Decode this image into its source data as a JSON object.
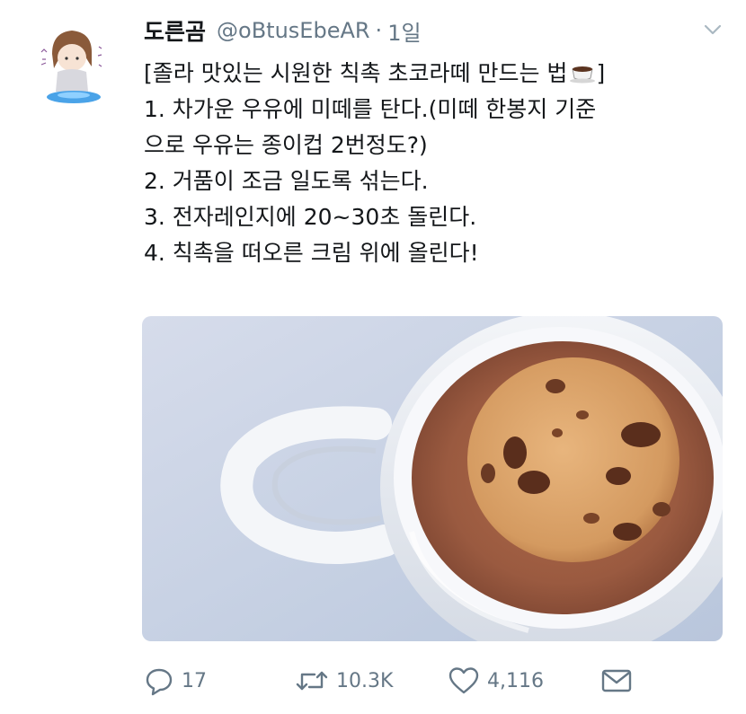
{
  "tweet": {
    "display_name": "도른곰",
    "handle": "@oBtusEbeAR",
    "separator": "·",
    "time": "1일",
    "text_lines": [
      "[졸라 맛있는 시원한 칙촉 초코라떼 만드는 법",
      "1. 차가운 우유에 미떼를 탄다.(미떼 한봉지 기준",
      "으로 우유는 종이컵 2번정도?)",
      "2. 거품이 조금 일도록 섞는다.",
      "3. 전자레인지에 20~30초 돌린다.",
      "4. 칙촉을 떠오른 크림 위에 올린다!"
    ],
    "title_closing_bracket": "]",
    "emoji_icon": "coffee-cup-emoji",
    "avatar_icon": "avatar-illustration"
  },
  "actions": {
    "reply_count": "17",
    "retweet_count": "10.3K",
    "like_count": "4,116"
  },
  "icons": {
    "reply": "speech-bubble-icon",
    "retweet": "retweet-arrows-icon",
    "like": "heart-icon",
    "dm": "envelope-icon",
    "caret": "chevron-down-icon"
  },
  "colors": {
    "text": "#14171a",
    "secondary": "#657786",
    "mug": "#eef1f4",
    "cocoa": "#9a5a40",
    "cookie": "#d9a26a",
    "chip": "#5a2e1c",
    "background": "#c7d2e3"
  }
}
